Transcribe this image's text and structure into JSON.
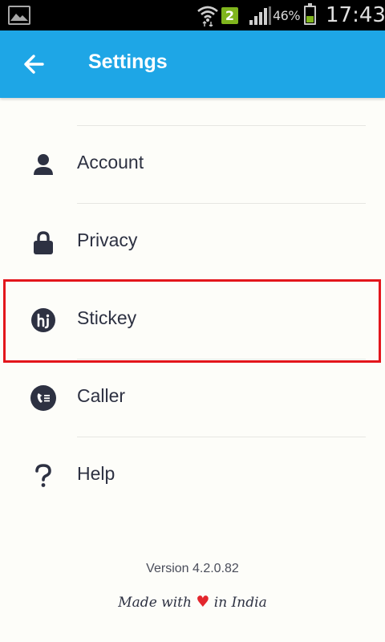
{
  "status_bar": {
    "sim_badge": "2",
    "battery_pct": "46%",
    "battery_level": 0.46,
    "time": "17:43",
    "icons": [
      "image-icon",
      "wifi-icon",
      "sim-icon",
      "signal-icon",
      "battery-icon"
    ]
  },
  "app_bar": {
    "title": "Settings",
    "back_icon": "arrow-left-icon",
    "background": "#1ea6e6"
  },
  "settings": {
    "items": [
      {
        "label": "Account",
        "icon": "account-icon"
      },
      {
        "label": "Privacy",
        "icon": "lock-icon"
      },
      {
        "label": "Stickey",
        "icon": "hike-logo-icon"
      },
      {
        "label": "Caller",
        "icon": "caller-icon"
      },
      {
        "label": "Help",
        "icon": "help-icon"
      }
    ],
    "highlighted": "Stickey",
    "highlight_color": "#e3161c"
  },
  "footer": {
    "version": "Version 4.2.0.82",
    "made_with_prefix": "Made with",
    "made_with_suffix": "in India",
    "heart_icon": "heart-icon",
    "heart_color": "#e3262d"
  }
}
